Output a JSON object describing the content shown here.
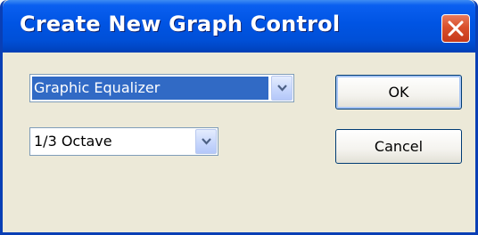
{
  "window": {
    "title": "Create New Graph Control",
    "close_icon": "close-icon"
  },
  "controls": {
    "graph_type": {
      "value": "Graphic Equalizer",
      "icon": "chevron-down-icon"
    },
    "bandwidth": {
      "value": "1/3 Octave",
      "icon": "chevron-down-icon"
    }
  },
  "buttons": {
    "ok_label": "OK",
    "cancel_label": "Cancel"
  },
  "colors": {
    "titlebar": "#0054e3",
    "selection": "#316ac5",
    "close": "#d9502c",
    "face": "#ece9d8"
  }
}
